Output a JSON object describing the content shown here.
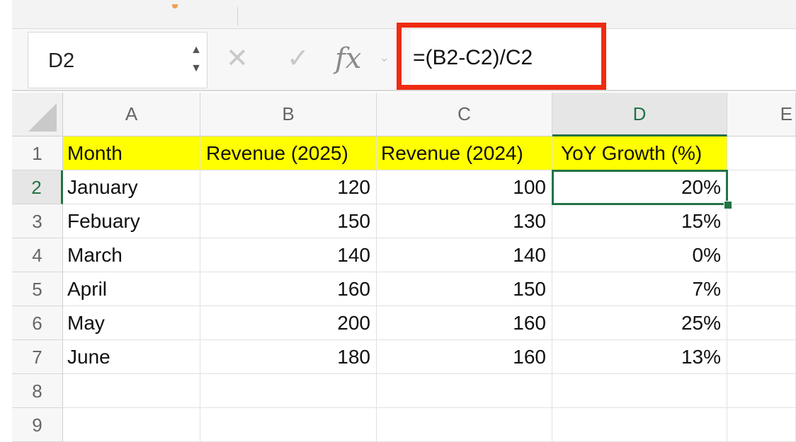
{
  "formula_bar": {
    "name_box": "D2",
    "stepper_up": "▲",
    "stepper_down": "▼",
    "cancel_icon": "✕",
    "enter_icon": "✓",
    "fx_label": "fx",
    "chevron": "⌄",
    "formula": "=(B2-C2)/C2",
    "highlight_color": "#ef2b11"
  },
  "columns": [
    "A",
    "B",
    "C",
    "D",
    "E"
  ],
  "selected_column": "D",
  "selected_row": "2",
  "row_numbers": [
    "1",
    "2",
    "3",
    "4",
    "5",
    "6",
    "7",
    "8",
    "9"
  ],
  "header_row": {
    "month": "Month",
    "rev2025": "Revenue (2025)",
    "rev2024": "Revenue (2024)",
    "growth": "YoY Growth (%)",
    "fill_color": "#ffff00"
  },
  "rows": [
    {
      "month": "January",
      "rev2025": "120",
      "rev2024": "100",
      "growth": "20%"
    },
    {
      "month": "Febuary",
      "rev2025": "150",
      "rev2024": "130",
      "growth": "15%"
    },
    {
      "month": "March",
      "rev2025": "140",
      "rev2024": "140",
      "growth": "0%"
    },
    {
      "month": "April",
      "rev2025": "160",
      "rev2024": "150",
      "growth": "7%"
    },
    {
      "month": "May",
      "rev2025": "200",
      "rev2024": "160",
      "growth": "25%"
    },
    {
      "month": "June",
      "rev2025": "180",
      "rev2024": "160",
      "growth": "13%"
    }
  ],
  "accent_color": "#217346"
}
